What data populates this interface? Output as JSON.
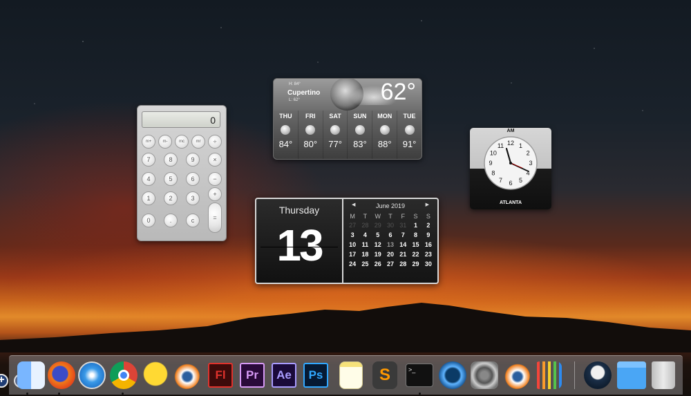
{
  "calculator": {
    "display": "0",
    "buttons": {
      "mem_plus": "m+",
      "mem_minus": "m-",
      "mem_clear": "mc",
      "mem_recall": "mr",
      "divide": "÷",
      "clear_entry": "×",
      "minus": "−",
      "plus": "+",
      "equals": "=",
      "n7": "7",
      "n8": "8",
      "n9": "9",
      "n4": "4",
      "n5": "5",
      "n6": "6",
      "n1": "1",
      "n2": "2",
      "n3": "3",
      "n0": "0",
      "dot": ".",
      "clear": "c"
    }
  },
  "weather": {
    "city": "Cupertino",
    "high": "H: 84°",
    "low": "L: 62°",
    "current_temp": "62°",
    "days": [
      {
        "name": "THU",
        "temp": "84°"
      },
      {
        "name": "FRI",
        "temp": "80°"
      },
      {
        "name": "SAT",
        "temp": "77°"
      },
      {
        "name": "SUN",
        "temp": "83°"
      },
      {
        "name": "MON",
        "temp": "88°"
      },
      {
        "name": "TUE",
        "temp": "91°"
      }
    ]
  },
  "clock": {
    "ampm": "AM",
    "city": "ATLANTA",
    "numerals": [
      "12",
      "1",
      "2",
      "3",
      "4",
      "5",
      "6",
      "7",
      "8",
      "9",
      "10",
      "11"
    ]
  },
  "calendar": {
    "weekday": "Thursday",
    "date": "13",
    "month": "June 2019",
    "prev": "◀",
    "next": "▶",
    "day_headers": [
      "M",
      "T",
      "W",
      "T",
      "F",
      "S",
      "S"
    ],
    "rows": [
      [
        "27",
        "28",
        "29",
        "30",
        "31",
        "1",
        "2"
      ],
      [
        "3",
        "4",
        "5",
        "6",
        "7",
        "8",
        "9"
      ],
      [
        "10",
        "11",
        "12",
        "13",
        "14",
        "15",
        "16"
      ],
      [
        "17",
        "18",
        "19",
        "20",
        "21",
        "22",
        "23"
      ],
      [
        "24",
        "25",
        "26",
        "27",
        "28",
        "29",
        "30"
      ]
    ]
  },
  "dock": {
    "items": [
      {
        "name": "finder"
      },
      {
        "name": "firefox"
      },
      {
        "name": "safari"
      },
      {
        "name": "chrome"
      },
      {
        "name": "cyberduck"
      },
      {
        "name": "blender"
      },
      {
        "name": "flash",
        "label": "Fl"
      },
      {
        "name": "premiere",
        "label": "Pr"
      },
      {
        "name": "after-effects",
        "label": "Ae"
      },
      {
        "name": "photoshop",
        "label": "Ps"
      },
      {
        "name": "notes"
      },
      {
        "name": "sublime-text"
      },
      {
        "name": "terminal",
        "label": ">_"
      },
      {
        "name": "quicktime"
      },
      {
        "name": "system-preferences"
      },
      {
        "name": "blender-2"
      },
      {
        "name": "activity-monitor"
      },
      {
        "name": "user-avatar"
      },
      {
        "name": "applications-folder"
      },
      {
        "name": "trash"
      }
    ]
  },
  "dashboard_controls": {
    "add": "+",
    "remove": "−"
  }
}
